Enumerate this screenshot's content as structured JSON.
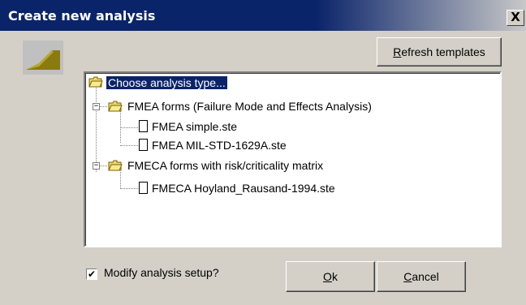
{
  "window": {
    "title": "Create new analysis",
    "close_glyph": "X"
  },
  "buttons": {
    "refresh": {
      "prefix": "",
      "underline": "R",
      "rest": "efresh templates"
    },
    "ok": {
      "prefix": "",
      "underline": "O",
      "rest": "k"
    },
    "cancel": {
      "prefix": "",
      "underline": "C",
      "rest": "ancel"
    }
  },
  "tree": {
    "root": {
      "label": "Choose analysis type...",
      "icon": "folder-open-icon",
      "selected": true
    },
    "groups": [
      {
        "label": "FMEA forms (Failure Mode and Effects Analysis)",
        "expanded": true,
        "items": [
          "FMEA simple.ste",
          "FMEA MIL-STD-1629A.ste"
        ]
      },
      {
        "label": "FMECA forms with risk/criticality matrix",
        "expanded": true,
        "items": [
          "FMECA Hoyland_Rausand-1994.ste"
        ]
      }
    ]
  },
  "modify_setup": {
    "label": "Modify analysis setup?",
    "checked": true,
    "check_glyph": "✔"
  },
  "colors": {
    "titlebar": "#0a246a",
    "selection": "#0a246a",
    "folder": "#e8d870",
    "logo": "#8a7a10"
  },
  "expander_glyph": "−"
}
